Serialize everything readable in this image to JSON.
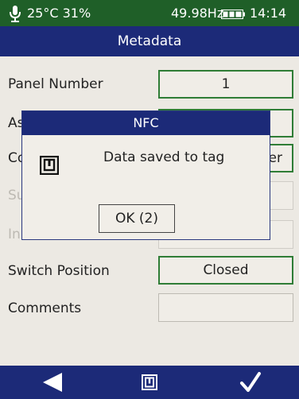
{
  "status": {
    "temperature": "25°C",
    "humidity": "31%",
    "frequency": "49.98Hz",
    "time": "14:14"
  },
  "header": {
    "title": "Metadata"
  },
  "form": {
    "panel_number_label": "Panel Number",
    "panel_number_value": "1",
    "asset_label_visible": "As",
    "connection_label_visible": "Co",
    "connection_value_visible": "er",
    "supply_label_visible": "Su",
    "installation_label_visible": "In",
    "switch_position_label": "Switch Position",
    "switch_position_value": "Closed",
    "comments_label": "Comments",
    "comments_value": ""
  },
  "dialog": {
    "title": "NFC",
    "message": "Data saved to tag",
    "ok_button": "OK (2)"
  },
  "toolbar": {
    "back_icon": "back-triangle-icon",
    "nfc_icon": "nfc-icon",
    "confirm_icon": "checkmark-icon"
  },
  "colors": {
    "status_bar": "#1f5f28",
    "title_bar": "#1c2a78",
    "field_border_active": "#2f7d36",
    "background": "#ece9e3"
  }
}
